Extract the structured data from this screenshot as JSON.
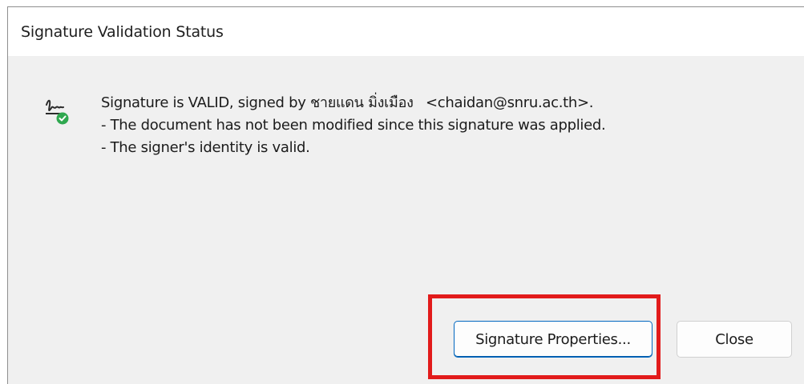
{
  "dialog": {
    "title": "Signature Validation Status"
  },
  "message": {
    "line1_prefix": "Signature is VALID, signed by",
    "signer_name": "ชายแดน มิ่งเมือง",
    "signer_email": "<chaidan@snru.ac.th>.",
    "line2": "- The document has not been modified since this signature was applied.",
    "line3": "- The signer's identity is valid."
  },
  "icons": {
    "status_icon": "valid-signature-icon"
  },
  "buttons": {
    "properties_label": "Signature Properties...",
    "close_label": "Close"
  },
  "annotation": {
    "highlight_color": "#e21b1b"
  }
}
